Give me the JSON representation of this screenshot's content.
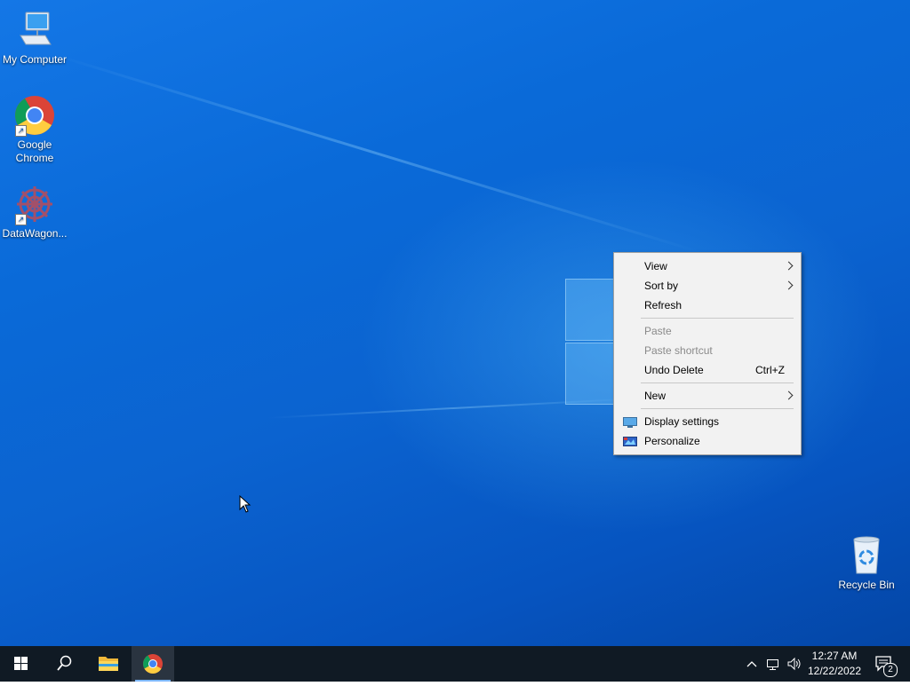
{
  "desktop": {
    "icons": [
      {
        "label": "My Computer"
      },
      {
        "label": "Google Chrome"
      },
      {
        "label": "DataWagon..."
      },
      {
        "label": "Recycle Bin"
      }
    ]
  },
  "context_menu": {
    "items": [
      {
        "label": "View",
        "submenu": true
      },
      {
        "label": "Sort by",
        "submenu": true
      },
      {
        "label": "Refresh"
      },
      {
        "label": "Paste",
        "disabled": true
      },
      {
        "label": "Paste shortcut",
        "disabled": true
      },
      {
        "label": "Undo Delete",
        "shortcut": "Ctrl+Z"
      },
      {
        "label": "New",
        "submenu": true
      },
      {
        "label": "Display settings",
        "icon": "display-settings-icon"
      },
      {
        "label": "Personalize",
        "icon": "personalize-icon"
      }
    ]
  },
  "taskbar": {
    "buttons": [
      "start-icon",
      "search-icon",
      "file-explorer-icon",
      "chrome-icon"
    ],
    "tray": {
      "icons": [
        "chevron-up-icon",
        "network-icon",
        "volume-icon"
      ],
      "time": "12:27 AM",
      "date": "12/22/2022",
      "notification_count": "2"
    }
  },
  "colors": {
    "taskbar_bg": "#101a24",
    "menu_bg": "#f2f2f2",
    "desktop_blue": "#0b63d0"
  }
}
